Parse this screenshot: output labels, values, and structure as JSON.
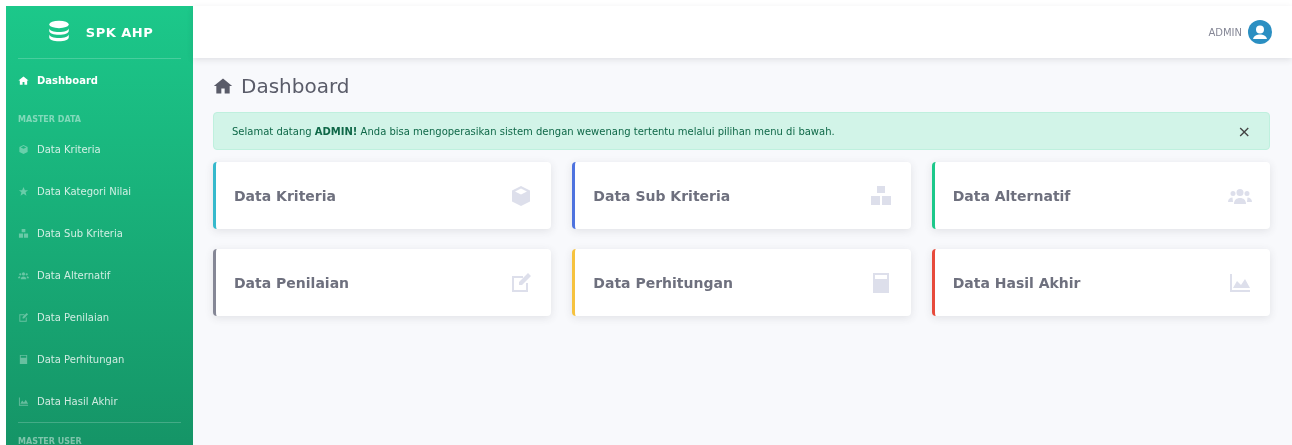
{
  "sidebar": {
    "brand": "SPK AHP",
    "items": [
      {
        "kind": "item",
        "label": "Dashboard",
        "selected": true
      },
      {
        "kind": "heading",
        "label": "MASTER DATA"
      },
      {
        "kind": "item",
        "label": "Data Kriteria",
        "selected": false
      },
      {
        "kind": "item",
        "label": "Data Kategori Nilai",
        "selected": false
      },
      {
        "kind": "item",
        "label": "Data Sub Kriteria",
        "selected": false
      },
      {
        "kind": "item",
        "label": "Data Alternatif",
        "selected": false
      },
      {
        "kind": "item",
        "label": "Data Penilaian",
        "selected": false
      },
      {
        "kind": "item",
        "label": "Data Perhitungan",
        "selected": false
      },
      {
        "kind": "item",
        "label": "Data Hasil Akhir",
        "selected": false
      },
      {
        "kind": "heading",
        "label": "MASTER USER"
      }
    ]
  },
  "topbar": {
    "user": "ADMIN"
  },
  "page_title": "Dashboard",
  "alert": {
    "text": "Selamat datang **ADMIN!** Anda bisa mengoperasikan sistem dengan wewenang tertentu melalui pilihan menu di bawah.",
    "close": "×"
  },
  "cards": [
    {
      "label": "Data Kriteria",
      "color": "#36b9cc"
    },
    {
      "label": "Data Sub Kriteria",
      "color": "#4e73df"
    },
    {
      "label": "Data Alternatif",
      "color": "#1cc88a"
    },
    {
      "label": "Data Penilaian",
      "color": "#858796"
    },
    {
      "label": "Data Perhitungan",
      "color": "#f6c23e"
    },
    {
      "label": "Data Hasil Akhir",
      "color": "#e74a3b"
    }
  ]
}
